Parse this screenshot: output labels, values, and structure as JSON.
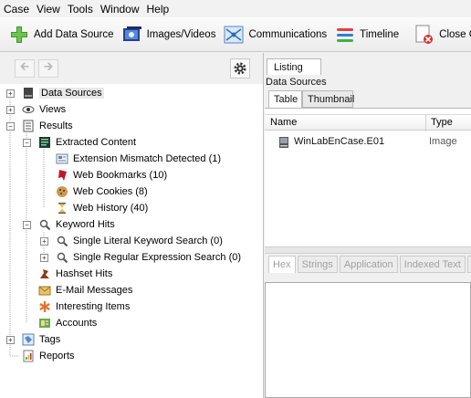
{
  "menu": [
    "Case",
    "View",
    "Tools",
    "Window",
    "Help"
  ],
  "toolbar": {
    "add_data_source": "Add Data Source",
    "images_videos": "Images/Videos",
    "communications": "Communications",
    "timeline": "Timeline",
    "close_case": "Close Case"
  },
  "nav": {
    "back": "back-arrow-icon",
    "forward": "forward-arrow-icon",
    "settings": "gear-icon"
  },
  "tree": {
    "data_sources": "Data Sources",
    "views": "Views",
    "results": "Results",
    "extracted_content": "Extracted Content",
    "extension_mismatch": "Extension Mismatch Detected (1)",
    "web_bookmarks": "Web Bookmarks (10)",
    "web_cookies": "Web Cookies (8)",
    "web_history": "Web History (40)",
    "keyword_hits": "Keyword Hits",
    "single_literal": "Single Literal Keyword Search (0)",
    "single_regex": "Single Regular Expression Search (0)",
    "hashset_hits": "Hashset Hits",
    "email_messages": "E-Mail Messages",
    "interesting_items": "Interesting Items",
    "accounts": "Accounts",
    "tags": "Tags",
    "reports": "Reports"
  },
  "listing": {
    "tab": "Listing",
    "breadcrumb": "Data Sources",
    "subtabs": {
      "table": "Table",
      "thumbnail": "Thumbnail"
    },
    "columns": {
      "name": "Name",
      "type": "Type"
    },
    "rows": [
      {
        "name": "WinLabEnCase.E01",
        "type": "Image"
      }
    ]
  },
  "content_tabs": {
    "hex": "Hex",
    "strings": "Strings",
    "application": "Application",
    "indexed_text": "Indexed Text",
    "more": "M"
  }
}
